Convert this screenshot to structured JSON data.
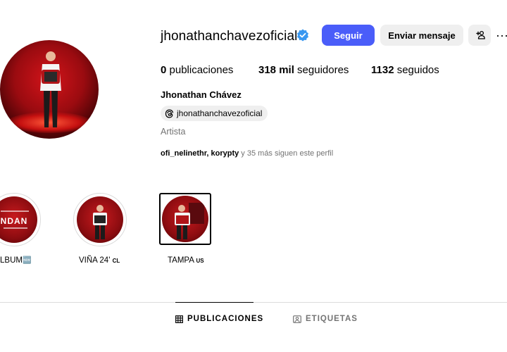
{
  "profile": {
    "username": "jhonathanchavezoficial",
    "full_name": "Jhonathan Chávez",
    "threads_handle": "jhonathanchavezoficial",
    "category": "Artista",
    "verified": true
  },
  "actions": {
    "follow_label": "Seguir",
    "message_label": "Enviar mensaje",
    "more_label": "···"
  },
  "stats": {
    "posts_value": "0",
    "posts_label": "publicaciones",
    "followers_value": "318 mil",
    "followers_label": "seguidores",
    "following_value": "1132",
    "following_label": "seguidos"
  },
  "followed_by": {
    "users": "ofi_nelinethr, korypty",
    "rest": " y 35 más siguen este perfil"
  },
  "highlights": [
    {
      "label": "LBUM",
      "emoji": "🆕"
    },
    {
      "label": "VIÑA 24'",
      "suffix": "CL"
    },
    {
      "label": "TAMPA",
      "suffix": "US"
    }
  ],
  "highlight_cover_text": "ANDAN",
  "tabs": {
    "posts_label": "PUBLICACIONES",
    "tagged_label": "ETIQUETAS"
  },
  "colors": {
    "accent": "#4a5df9",
    "secondary_text": "#737373",
    "button_bg": "#efefef",
    "verified": "#3897f0"
  }
}
